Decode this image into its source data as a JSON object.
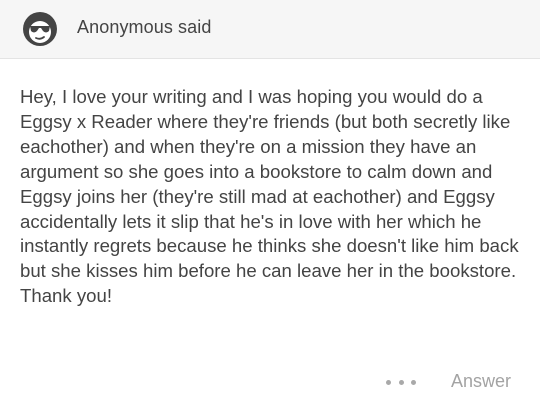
{
  "ask": {
    "asker": "Anonymous said",
    "avatar_icon": "sunglasses-face-icon",
    "question": "Hey, I love your writing and I was hoping you would do a Eggsy x Reader where they're friends (but both secretly like eachother) and when they're on a mission they have an argument so she goes into a bookstore to calm down and Eggsy joins her (they're still mad at eachother) and Eggsy accidentally lets it slip that he's in love with her which he instantly regrets because he thinks she doesn't like him back but she kisses him before he can leave her in the bookstore. Thank you!"
  },
  "actions": {
    "more_icon": "ellipsis-icon",
    "answer_label": "Answer"
  },
  "colors": {
    "text": "#444444",
    "muted": "#a3a3a3",
    "header_bg": "#f6f6f6"
  }
}
